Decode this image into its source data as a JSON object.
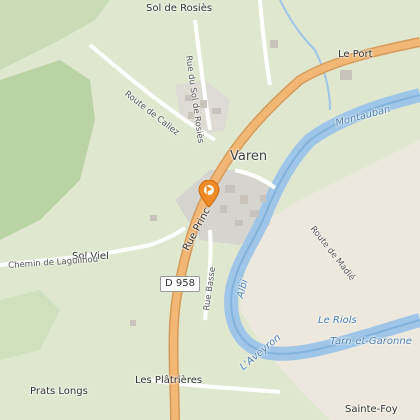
{
  "map": {
    "places": {
      "sol_de_rosies": "Sol de Rosiès",
      "le_port": "Le Port",
      "varen": "Varen",
      "sol_viel": "Sol Viel",
      "prats_longs": "Prats Longs",
      "les_platrieres": "Les Plâtrières",
      "sainte_foy": "Sainte-Foy",
      "montauban": "Montauban",
      "le_riols": "Le Riols",
      "tarn_et_garonne": "Tarn-et-Garonne",
      "albi": "Albi"
    },
    "roads": {
      "route_de_caliez": "Route de Caliez",
      "rue_du_sol_de_rosies": "Rue du Sol de Rosiès",
      "rue_principale": "Rue Princ",
      "rue_basse": "Rue Basse",
      "chemin_de_laguilhou": "Chemin de Laguilhou",
      "route_de_madie": "Route de Madié",
      "shield_d958": "D 958"
    },
    "river": {
      "name": "L'Aveyron"
    },
    "marker": {
      "icon": "location-pin-icon",
      "color": "#f08a24"
    },
    "colors": {
      "main_road": "#f2b774",
      "river": "#9fc6e8",
      "forest": "#b9d3a5",
      "meadow": "#dfe8cf",
      "farmland": "#ece8dd"
    }
  }
}
